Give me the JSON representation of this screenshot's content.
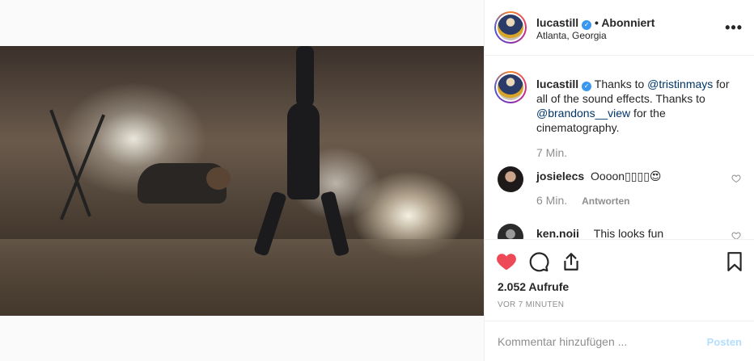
{
  "post": {
    "username": "lucastill",
    "follow_status": "Abonniert",
    "location": "Atlanta, Georgia",
    "more_icon": "more-options-icon"
  },
  "caption": {
    "username": "lucastill",
    "part1": "Thanks to ",
    "mention1": "@tristinmays",
    "part2": " for all of the sound effects. Thanks to ",
    "mention2": "@brandons__view",
    "part3": " for the cinematography.",
    "time": "7 Min."
  },
  "comments": [
    {
      "username": "josielecs",
      "text": "Oooon▯▯▯▯😍",
      "time": "6 Min.",
      "reply": "Antworten"
    },
    {
      "username": "ken.noii",
      "text": "This looks fun"
    }
  ],
  "actions": {
    "views": "2.052 Aufrufe",
    "posted_ago": "VOR 7 MINUTEN",
    "like_color": "#ed4956"
  },
  "add_comment": {
    "placeholder": "Kommentar hinzufügen ...",
    "post_label": "Posten"
  }
}
